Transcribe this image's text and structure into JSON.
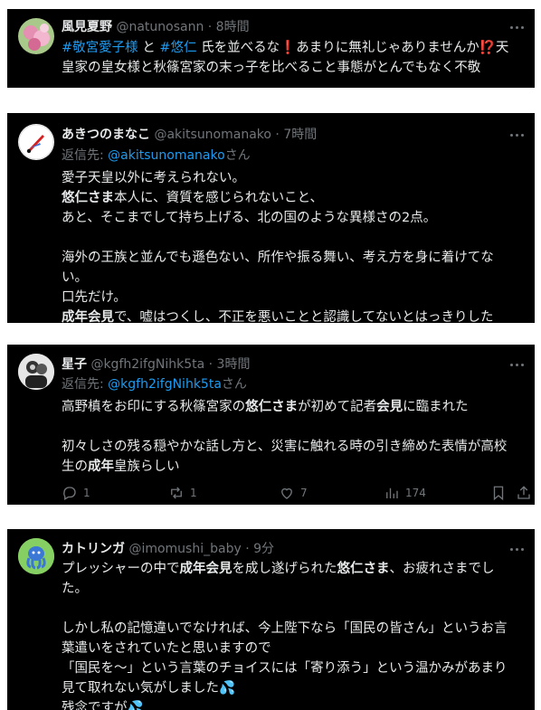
{
  "tweets": [
    {
      "name": "風見夏野",
      "handle": "@natunosann",
      "time": "· 8時間",
      "lines": [
        [
          {
            "t": "#敬宮愛子様",
            "c": "tag"
          },
          {
            "t": " と "
          },
          {
            "t": "#悠仁",
            "c": "tag"
          },
          {
            "t": " 氏を並べるな"
          },
          {
            "t": "❗",
            "c": "em"
          },
          {
            "t": "あまりに無礼じゃありませんか"
          },
          {
            "t": "⁉️",
            "c": "em"
          },
          {
            "t": "天"
          }
        ],
        [
          {
            "t": "皇家の皇女様と秋篠宮家の末っ子を比べること事態がとんでもなく不敬"
          }
        ]
      ]
    },
    {
      "name": "あきつのまなこ",
      "handle": "@akitsunomanako",
      "time": "· 7時間",
      "reply_prefix": "返信先: ",
      "reply_to": "@akitsunomanako",
      "reply_suffix": "さん",
      "lines": [
        [
          {
            "t": "愛子天皇以外に考えられない。"
          }
        ],
        [
          {
            "t": "悠仁さま",
            "c": "b"
          },
          {
            "t": "本人に、資質を感じられないこと、"
          }
        ],
        [
          {
            "t": "あと、そこまでして持ち上げる、北の国のような異様さの2点。"
          }
        ],
        [],
        [
          {
            "t": "海外の王族と並んでも遜色ない、所作や振る舞い、考え方を身に着けてな"
          }
        ],
        [
          {
            "t": "い。"
          }
        ],
        [
          {
            "t": "口先だけ。"
          }
        ],
        [
          {
            "t": "成年会見",
            "c": "b"
          },
          {
            "t": "で、嘘はつくし、不正を悪いことと認識してないとはっきりした"
          }
        ]
      ]
    },
    {
      "name": "星子",
      "handle": "@kgfh2ifgNihk5ta",
      "time": "· 3時間",
      "reply_prefix": "返信先: ",
      "reply_to": "@kgfh2ifgNihk5ta",
      "reply_suffix": "さん",
      "lines": [
        [
          {
            "t": "高野槙をお印にする秋篠宮家の"
          },
          {
            "t": "悠仁さま",
            "c": "b"
          },
          {
            "t": "が初めて記者"
          },
          {
            "t": "会見",
            "c": "b"
          },
          {
            "t": "に臨まれた"
          }
        ],
        [],
        [
          {
            "t": "初々しさの残る穏やかな話し方と、災害に触れる時の引き締めた表情が高校"
          }
        ],
        [
          {
            "t": "生の"
          },
          {
            "t": "成年",
            "c": "b"
          },
          {
            "t": "皇族らしい"
          }
        ]
      ],
      "actions": {
        "replies": "1",
        "retweets": "1",
        "likes": "7",
        "views": "174"
      }
    },
    {
      "name": "カトリンガ",
      "handle": "@imomushi_baby",
      "time": "· 9分",
      "lines": [
        [
          {
            "t": "プレッシャーの中で"
          },
          {
            "t": "成年会見",
            "c": "b"
          },
          {
            "t": "を成し遂げられた"
          },
          {
            "t": "悠仁さま",
            "c": "b"
          },
          {
            "t": "、お疲れさまでし"
          }
        ],
        [
          {
            "t": "た。"
          }
        ],
        [],
        [
          {
            "t": "しかし私の記憶違いでなければ、今上陛下なら「国民の皆さん」というお言"
          }
        ],
        [
          {
            "t": "葉遣いをされていたと思いますので"
          }
        ],
        [
          {
            "t": "「国民を～」という言葉のチョイスには「寄り添う」という温かみがあまり"
          }
        ],
        [
          {
            "t": "見て取れない気がしました"
          },
          {
            "t": "💦",
            "c": "drop"
          }
        ],
        [
          {
            "t": "残念ですが"
          },
          {
            "t": "💦",
            "c": "drop"
          }
        ]
      ]
    }
  ],
  "icons": {
    "more": "more-icon",
    "reply": "reply-icon",
    "retweet": "retweet-icon",
    "like": "like-icon",
    "views": "views-icon",
    "bookmark": "bookmark-icon",
    "share": "share-icon"
  },
  "colors": {
    "background": "#000000",
    "text": "#e7e9ea",
    "muted": "#71767b",
    "link": "#1d9bf0",
    "emphasis": "#f4212e"
  }
}
